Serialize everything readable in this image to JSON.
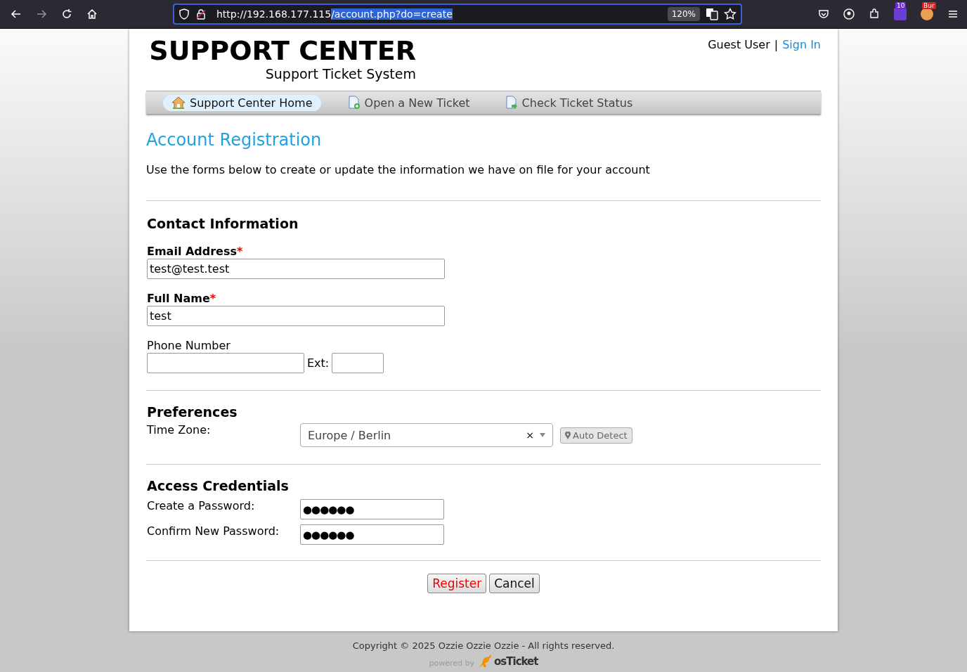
{
  "browser": {
    "url_host": "http://192.168.177.115",
    "url_path": "/account.php?do=create",
    "zoom": "120%",
    "badges": [
      {
        "text": "10",
        "kind": "count"
      },
      {
        "text": "Bur",
        "kind": "label"
      }
    ]
  },
  "header": {
    "title": "SUPPORT CENTER",
    "subtitle": "Support Ticket System",
    "user": "Guest User",
    "separator": "|",
    "sign_in": "Sign In"
  },
  "nav": [
    {
      "label": "Support Center Home",
      "kind": "home",
      "selected": true
    },
    {
      "label": "Open a New Ticket",
      "kind": "new",
      "selected": false
    },
    {
      "label": "Check Ticket Status",
      "kind": "status",
      "selected": false
    }
  ],
  "page": {
    "title": "Account Registration",
    "intro": "Use the forms below to create or update the information we have on file for your account"
  },
  "contact": {
    "heading": "Contact Information",
    "fields": [
      {
        "label": "Email Address",
        "required_mark": "*",
        "value": "test@test.test"
      },
      {
        "label": "Full Name",
        "required_mark": "*",
        "value": "test"
      }
    ],
    "phone": {
      "label": "Phone Number",
      "ext_label": "Ext:"
    }
  },
  "preferences": {
    "heading": "Preferences",
    "timezone_label": "Time Zone:",
    "timezone_value": "Europe / Berlin",
    "clear": "×",
    "auto_detect": "Auto Detect"
  },
  "credentials": {
    "heading": "Access Credentials",
    "fields": [
      {
        "label": "Create a Password:",
        "value": "●●●●●●"
      },
      {
        "label": "Confirm New Password:",
        "value": "●●●●●●"
      }
    ]
  },
  "buttons": [
    {
      "label": "Register",
      "kind": "primary"
    },
    {
      "label": "Cancel",
      "kind": "default"
    }
  ],
  "footer": {
    "copyright": "Copyright © 2025 Ozzie Ozzie Ozzie - All rights reserved.",
    "powered_by": "powered by",
    "brand": "osTicket"
  }
}
